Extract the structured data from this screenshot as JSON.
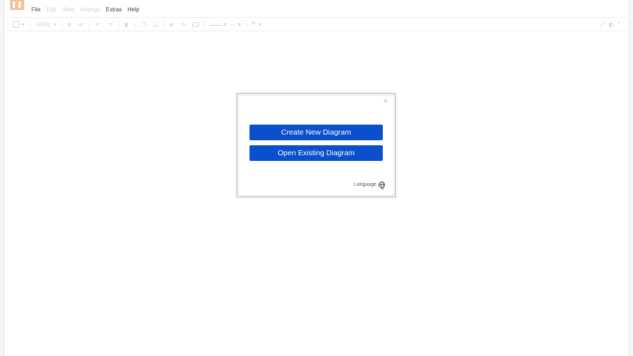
{
  "menubar": {
    "items": [
      {
        "label": "File",
        "state": "active"
      },
      {
        "label": "Edit",
        "state": "dim"
      },
      {
        "label": "View",
        "state": "dim"
      },
      {
        "label": "Arrange",
        "state": "dim"
      },
      {
        "label": "Extras",
        "state": "active"
      },
      {
        "label": "Help",
        "state": "active"
      }
    ]
  },
  "toolbar": {
    "zoom": "100%",
    "icons": [
      "page-view-icon",
      "zoom-in-icon",
      "zoom-out-icon",
      "undo-icon",
      "redo-icon",
      "delete-icon",
      "to-front-icon",
      "to-back-icon",
      "fill-color-icon",
      "line-color-icon",
      "shadow-icon",
      "connection-icon",
      "waypoints-icon",
      "insert-icon",
      "fullscreen-icon",
      "format-panel-icon",
      "collapse-icon"
    ]
  },
  "dialog": {
    "close_label": "×",
    "create_label": "Create New Diagram",
    "open_label": "Open Existing Diagram",
    "language_label": "Language"
  },
  "colors": {
    "primary_button": "#0a4fcb",
    "logo": "#f5c29a",
    "menu_active": "#444444",
    "menu_dim": "#d2d2d2"
  }
}
